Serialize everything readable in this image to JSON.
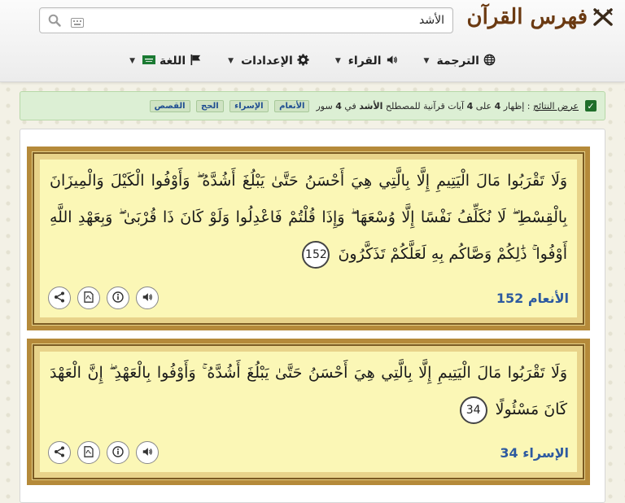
{
  "header": {
    "logo_text": "فهرس القرآن",
    "search_value": "الأشد"
  },
  "menu": [
    {
      "label": "الترجمة",
      "icon": "globe-icon"
    },
    {
      "label": "القراء",
      "icon": "speaker-icon"
    },
    {
      "label": "الإعدادات",
      "icon": "gear-icon"
    },
    {
      "label": "اللغة",
      "icon": "flag-icon"
    }
  ],
  "notice": {
    "prefix": "عرض النتائج",
    "text_1": ": إظهار",
    "count": "4",
    "text_2": "على",
    "count2": "4",
    "text_3": "آيات قرآنية للمصطلح",
    "term": "الأشد",
    "text_4": "في",
    "surah_count": "4",
    "text_5": "سور",
    "tags": [
      "الأنعام",
      "الإسراء",
      "الحج",
      "القصص"
    ]
  },
  "results": [
    {
      "text": "وَلَا تَقْرَبُوا مَالَ الْيَتِيمِ إِلَّا بِالَّتِي هِيَ أَحْسَنُ حَتَّىٰ يَبْلُغَ أَشُدَّهُ ۖ وَأَوْفُوا الْكَيْلَ وَالْمِيزَانَ بِالْقِسْطِ ۖ لَا نُكَلِّفُ نَفْسًا إِلَّا وُسْعَهَا ۖ وَإِذَا قُلْتُمْ فَاعْدِلُوا وَلَوْ كَانَ ذَا قُرْبَىٰ ۖ وَبِعَهْدِ اللَّهِ أَوْفُوا ۚ ذَٰلِكُمْ وَصَّاكُم بِهِ لَعَلَّكُمْ تَذَكَّرُونَ",
      "number": "152",
      "reference": "الأنعام 152"
    },
    {
      "text": "وَلَا تَقْرَبُوا مَالَ الْيَتِيمِ إِلَّا بِالَّتِي هِيَ أَحْسَنُ حَتَّىٰ يَبْلُغَ أَشُدَّهُ ۚ وَأَوْفُوا بِالْعَهْدِ ۖ إِنَّ الْعَهْدَ كَانَ مَسْئُولًا",
      "number": "34",
      "reference": "الإسراء 34"
    }
  ]
}
